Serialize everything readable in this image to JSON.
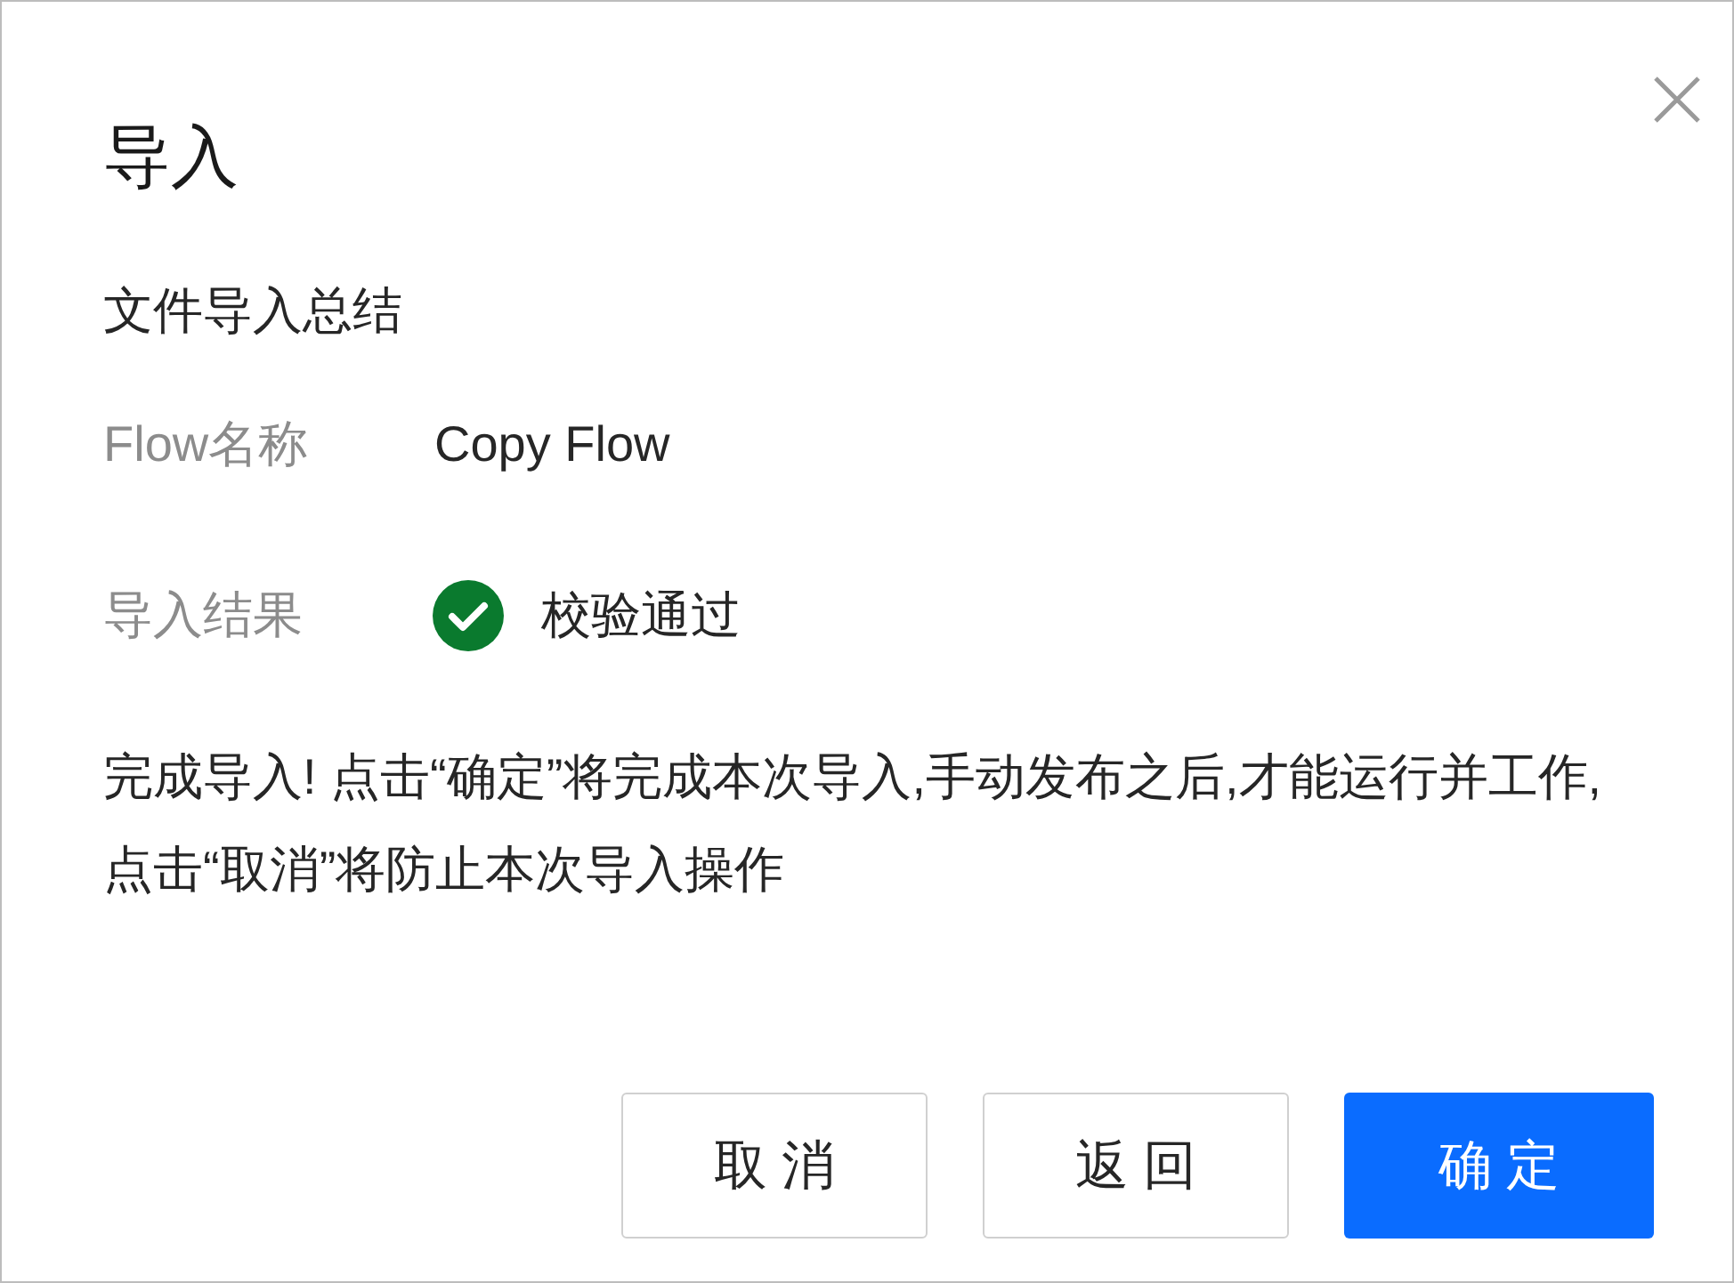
{
  "dialog": {
    "title": "导入",
    "summary_heading": "文件导入总结",
    "fields": [
      {
        "label": "Flow名称",
        "value": "Copy Flow",
        "kind": "text"
      },
      {
        "label": "导入结果",
        "value": "校验通过",
        "kind": "status"
      }
    ],
    "message": "完成导入! 点击“确定”将完成本次导入,手动发布之后,才能运行并工作,点击“取消”将防止本次导入操作",
    "buttons": [
      {
        "label": "取 消",
        "kind": "default"
      },
      {
        "label": "返 回",
        "kind": "default"
      },
      {
        "label": "确 定",
        "kind": "primary"
      }
    ]
  }
}
